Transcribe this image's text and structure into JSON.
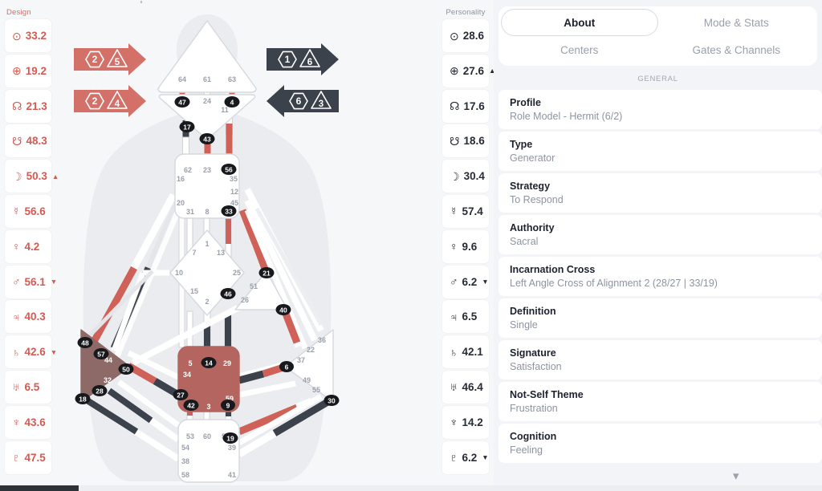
{
  "design": {
    "title": "Design",
    "color": "#d55a52",
    "rows": [
      {
        "icon": "sun-icon",
        "glyph": "⊙",
        "value": "33.2",
        "arrow": ""
      },
      {
        "icon": "earth-icon",
        "glyph": "⊕",
        "value": "19.2",
        "arrow": ""
      },
      {
        "icon": "north-node-icon",
        "glyph": "☊",
        "value": "21.3",
        "arrow": ""
      },
      {
        "icon": "south-node-icon",
        "glyph": "☋",
        "value": "48.3",
        "arrow": ""
      },
      {
        "icon": "moon-icon",
        "glyph": "☽",
        "value": "50.3",
        "arrow": "▲"
      },
      {
        "icon": "mercury-icon",
        "glyph": "☿",
        "value": "56.6",
        "arrow": ""
      },
      {
        "icon": "venus-icon",
        "glyph": "♀",
        "value": "4.2",
        "arrow": ""
      },
      {
        "icon": "mars-icon",
        "glyph": "♂",
        "value": "56.1",
        "arrow": "▼"
      },
      {
        "icon": "jupiter-icon",
        "glyph": "♃",
        "value": "40.3",
        "arrow": ""
      },
      {
        "icon": "saturn-icon",
        "glyph": "♄",
        "value": "42.6",
        "arrow": "▼"
      },
      {
        "icon": "uranus-icon",
        "glyph": "♅",
        "value": "6.5",
        "arrow": ""
      },
      {
        "icon": "neptune-icon",
        "glyph": "♆",
        "value": "43.6",
        "arrow": ""
      },
      {
        "icon": "pluto-icon",
        "glyph": "♇",
        "value": "47.5",
        "arrow": ""
      }
    ]
  },
  "personality": {
    "title": "Personality",
    "color": "#262b36",
    "rows": [
      {
        "icon": "sun-icon",
        "glyph": "⊙",
        "value": "28.6",
        "arrow": ""
      },
      {
        "icon": "earth-icon",
        "glyph": "⊕",
        "value": "27.6",
        "arrow": "▲"
      },
      {
        "icon": "north-node-icon",
        "glyph": "☊",
        "value": "17.6",
        "arrow": ""
      },
      {
        "icon": "south-node-icon",
        "glyph": "☋",
        "value": "18.6",
        "arrow": ""
      },
      {
        "icon": "moon-icon",
        "glyph": "☽",
        "value": "30.4",
        "arrow": ""
      },
      {
        "icon": "mercury-icon",
        "glyph": "☿",
        "value": "57.4",
        "arrow": ""
      },
      {
        "icon": "venus-icon",
        "glyph": "♀",
        "value": "9.6",
        "arrow": ""
      },
      {
        "icon": "mars-icon",
        "glyph": "♂",
        "value": "6.2",
        "arrow": "▼"
      },
      {
        "icon": "jupiter-icon",
        "glyph": "♃",
        "value": "6.5",
        "arrow": ""
      },
      {
        "icon": "saturn-icon",
        "glyph": "♄",
        "value": "42.1",
        "arrow": ""
      },
      {
        "icon": "uranus-icon",
        "glyph": "♅",
        "value": "46.4",
        "arrow": ""
      },
      {
        "icon": "neptune-icon",
        "glyph": "♆",
        "value": "14.2",
        "arrow": ""
      },
      {
        "icon": "pluto-icon",
        "glyph": "♇",
        "value": "6.2",
        "arrow": "▼"
      }
    ]
  },
  "arrows": [
    {
      "id": "design-arrow-top",
      "side": "left",
      "direction": "right",
      "hex": "2",
      "tri": "5",
      "color": "#d37068"
    },
    {
      "id": "design-arrow-bottom",
      "side": "left",
      "direction": "right",
      "hex": "2",
      "tri": "4",
      "color": "#d37068"
    },
    {
      "id": "personality-arrow-top",
      "side": "right",
      "direction": "right",
      "hex": "1",
      "tri": "6",
      "color": "#3c424c"
    },
    {
      "id": "personality-arrow-bottom",
      "side": "right",
      "direction": "left",
      "hex": "6",
      "tri": "3",
      "color": "#3c424c"
    }
  ],
  "tabs": [
    {
      "label": "About",
      "active": true
    },
    {
      "label": "Mode & Stats",
      "active": false
    },
    {
      "label": "Centers",
      "active": false
    },
    {
      "label": "Gates & Channels",
      "active": false
    }
  ],
  "panel": {
    "section_label": "GENERAL",
    "items": [
      {
        "key": "Profile",
        "value": "Role Model - Hermit (6/2)"
      },
      {
        "key": "Type",
        "value": "Generator"
      },
      {
        "key": "Strategy",
        "value": "To Respond"
      },
      {
        "key": "Authority",
        "value": "Sacral"
      },
      {
        "key": "Incarnation Cross",
        "value": "Left Angle Cross of Alignment 2 (28/27 | 33/19)"
      },
      {
        "key": "Definition",
        "value": "Single"
      },
      {
        "key": "Signature",
        "value": "Satisfaction"
      },
      {
        "key": "Not-Self Theme",
        "value": "Frustration"
      },
      {
        "key": "Cognition",
        "value": "Feeling"
      }
    ],
    "expand_icon": "chevron-down-icon"
  },
  "bodygraph": {
    "colors": {
      "design_red": "#cf6158",
      "personality_dark": "#3c424c",
      "sacral_fill": "#b4655f",
      "spleen_fill": "#8d6a68",
      "undefined_fill": "#ffffff",
      "gate_inactive": "#9aa0ab",
      "body_silhouette": "#e8e9ec"
    },
    "centers": [
      {
        "name": "head",
        "defined": false,
        "gates": [
          "64",
          "61",
          "63"
        ]
      },
      {
        "name": "ajna",
        "defined": false,
        "gates": [
          "47",
          "24",
          "4"
        ]
      },
      {
        "name": "throat",
        "defined": false,
        "gates": [
          "62",
          "23",
          "56",
          "16",
          "35",
          "12",
          "20",
          "45",
          "31",
          "8",
          "33"
        ]
      },
      {
        "name": "g-center",
        "defined": false,
        "gates": [
          "1",
          "7",
          "13",
          "10",
          "25",
          "15",
          "46",
          "2"
        ]
      },
      {
        "name": "heart",
        "defined": false,
        "gates": [
          "21",
          "51",
          "26",
          "40"
        ]
      },
      {
        "name": "spleen",
        "defined": true,
        "gates": [
          "48",
          "57",
          "44",
          "50",
          "32",
          "28",
          "18"
        ]
      },
      {
        "name": "sacral",
        "defined": true,
        "gates": [
          "5",
          "14",
          "29",
          "34",
          "27",
          "59",
          "42",
          "3",
          "9"
        ]
      },
      {
        "name": "solar-plexus",
        "defined": false,
        "gates": [
          "36",
          "22",
          "37",
          "6",
          "49",
          "55",
          "30"
        ]
      },
      {
        "name": "root",
        "defined": false,
        "gates": [
          "53",
          "60",
          "52",
          "54",
          "19",
          "38",
          "39",
          "58",
          "41"
        ]
      }
    ],
    "activated_gates": [
      "47",
      "4",
      "17",
      "43",
      "56",
      "33",
      "46",
      "21",
      "40",
      "6",
      "30",
      "48",
      "57",
      "50",
      "28",
      "18",
      "14",
      "27",
      "42",
      "9",
      "19"
    ],
    "floating_gates": [
      "17",
      "11",
      "43"
    ]
  }
}
